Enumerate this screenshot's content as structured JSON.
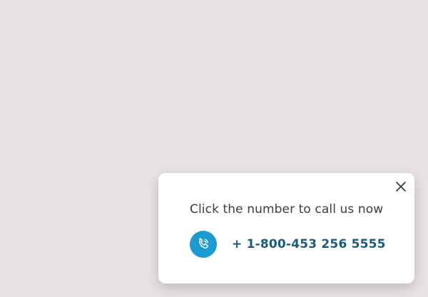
{
  "popup": {
    "message": "Click the number to call us now",
    "phone_number": "+ 1-800-453 256 5555",
    "close_icon": "close-icon",
    "phone_icon": "phone-call-icon"
  },
  "colors": {
    "background": "#e8e2e2",
    "popup_background": "#ffffff",
    "accent": "#1c9bd1",
    "phone_text": "#1a5a7c",
    "message_text": "#3d3d3d"
  }
}
